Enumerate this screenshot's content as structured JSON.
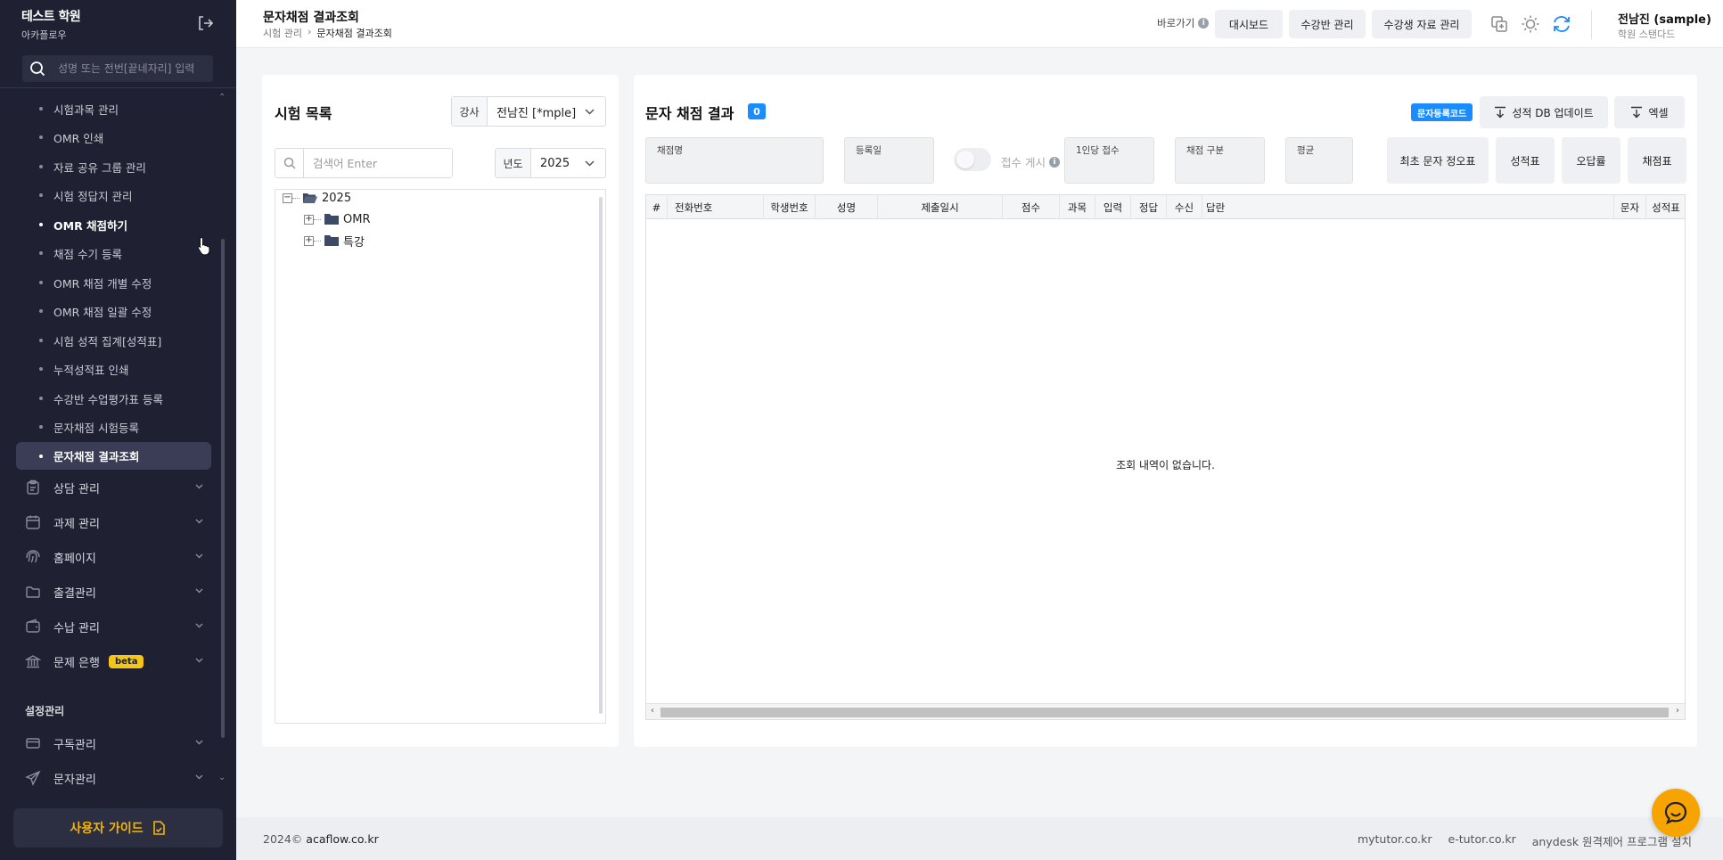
{
  "brand": {
    "name": "테스트 학원",
    "sub": "아카플로우"
  },
  "sidebar": {
    "search_placeholder": "성명 또는 전번[끝네자리] 입력",
    "sub_items": [
      {
        "label": "시험과목 관리"
      },
      {
        "label": "OMR 인쇄"
      },
      {
        "label": "자료 공유 그룹 관리"
      },
      {
        "label": "시험 정답지 관리"
      },
      {
        "label": "OMR 채점하기"
      },
      {
        "label": "채점 수기 등록"
      },
      {
        "label": "OMR 채점 개별 수정"
      },
      {
        "label": "OMR 채점 일괄 수정"
      },
      {
        "label": "시험 성적 집계[성적표]"
      },
      {
        "label": "누적성적표 인쇄"
      },
      {
        "label": "수강반 수업평가표 등록"
      },
      {
        "label": "문자채점 시험등록"
      },
      {
        "label": "문자채점 결과조회"
      }
    ],
    "menus": [
      {
        "label": "상담 관리",
        "icon": "clipboard-icon"
      },
      {
        "label": "과제 관리",
        "icon": "calendar-icon"
      },
      {
        "label": "홈페이지",
        "icon": "fingerprint-icon"
      },
      {
        "label": "출결관리",
        "icon": "folder-icon"
      },
      {
        "label": "수납 관리",
        "icon": "wallet-icon"
      },
      {
        "label": "문제 은행",
        "icon": "bank-icon",
        "badge": "beta"
      }
    ],
    "section_label": "설정관리",
    "settings_menus": [
      {
        "label": "구독관리",
        "icon": "card-icon"
      },
      {
        "label": "문자관리",
        "icon": "send-icon"
      }
    ],
    "guide_label": "사용자 가이드"
  },
  "header": {
    "title": "문자채점 결과조회",
    "breadcrumb": [
      "시험 관리",
      "문자채점 결과조회"
    ],
    "quick_label": "바로가기",
    "buttons": [
      "대시보드",
      "수강반 관리",
      "수강생 자료 관리"
    ],
    "user_name": "전남진 (sample)",
    "user_plan": "학원 스탠다드"
  },
  "left_panel": {
    "title": "시험 목록",
    "teacher_label": "강사",
    "teacher_value": "전남진 [*mple]",
    "search_placeholder": "검색어 Enter",
    "year_label": "년도",
    "year_value": "2025",
    "tree": {
      "root": "2025",
      "children": [
        "OMR",
        "특강"
      ]
    }
  },
  "right_panel": {
    "title": "문자 채점 결과",
    "count": "0",
    "code_badge": "문자등록코드",
    "db_update_label": "성적 DB 업데이트",
    "excel_label": "엑셀",
    "fields": [
      "채점명",
      "등록일",
      "1인당 접수",
      "채점 구분",
      "평균"
    ],
    "toggle_label": "접수 게시",
    "action_buttons": [
      "최초 문자 정오표",
      "성적표",
      "오답률",
      "채점표"
    ],
    "columns": [
      "#",
      "전화번호",
      "학생번호",
      "성명",
      "제출일시",
      "점수",
      "과목",
      "입력",
      "정답",
      "수신",
      "답란",
      "문자",
      "성적표"
    ],
    "empty_message": "조회 내역이 없습니다."
  },
  "footer": {
    "copyright": "2024©",
    "site": "acaflow.co.kr",
    "links": [
      "mytutor.co.kr",
      "e-tutor.co.kr",
      "anydesk 원격제어 프로그램 설치"
    ]
  },
  "colors": {
    "sidebar_bg": "#1f2133",
    "accent": "#1a8cff",
    "guide": "#f7b500",
    "chat": "#f7a400"
  }
}
